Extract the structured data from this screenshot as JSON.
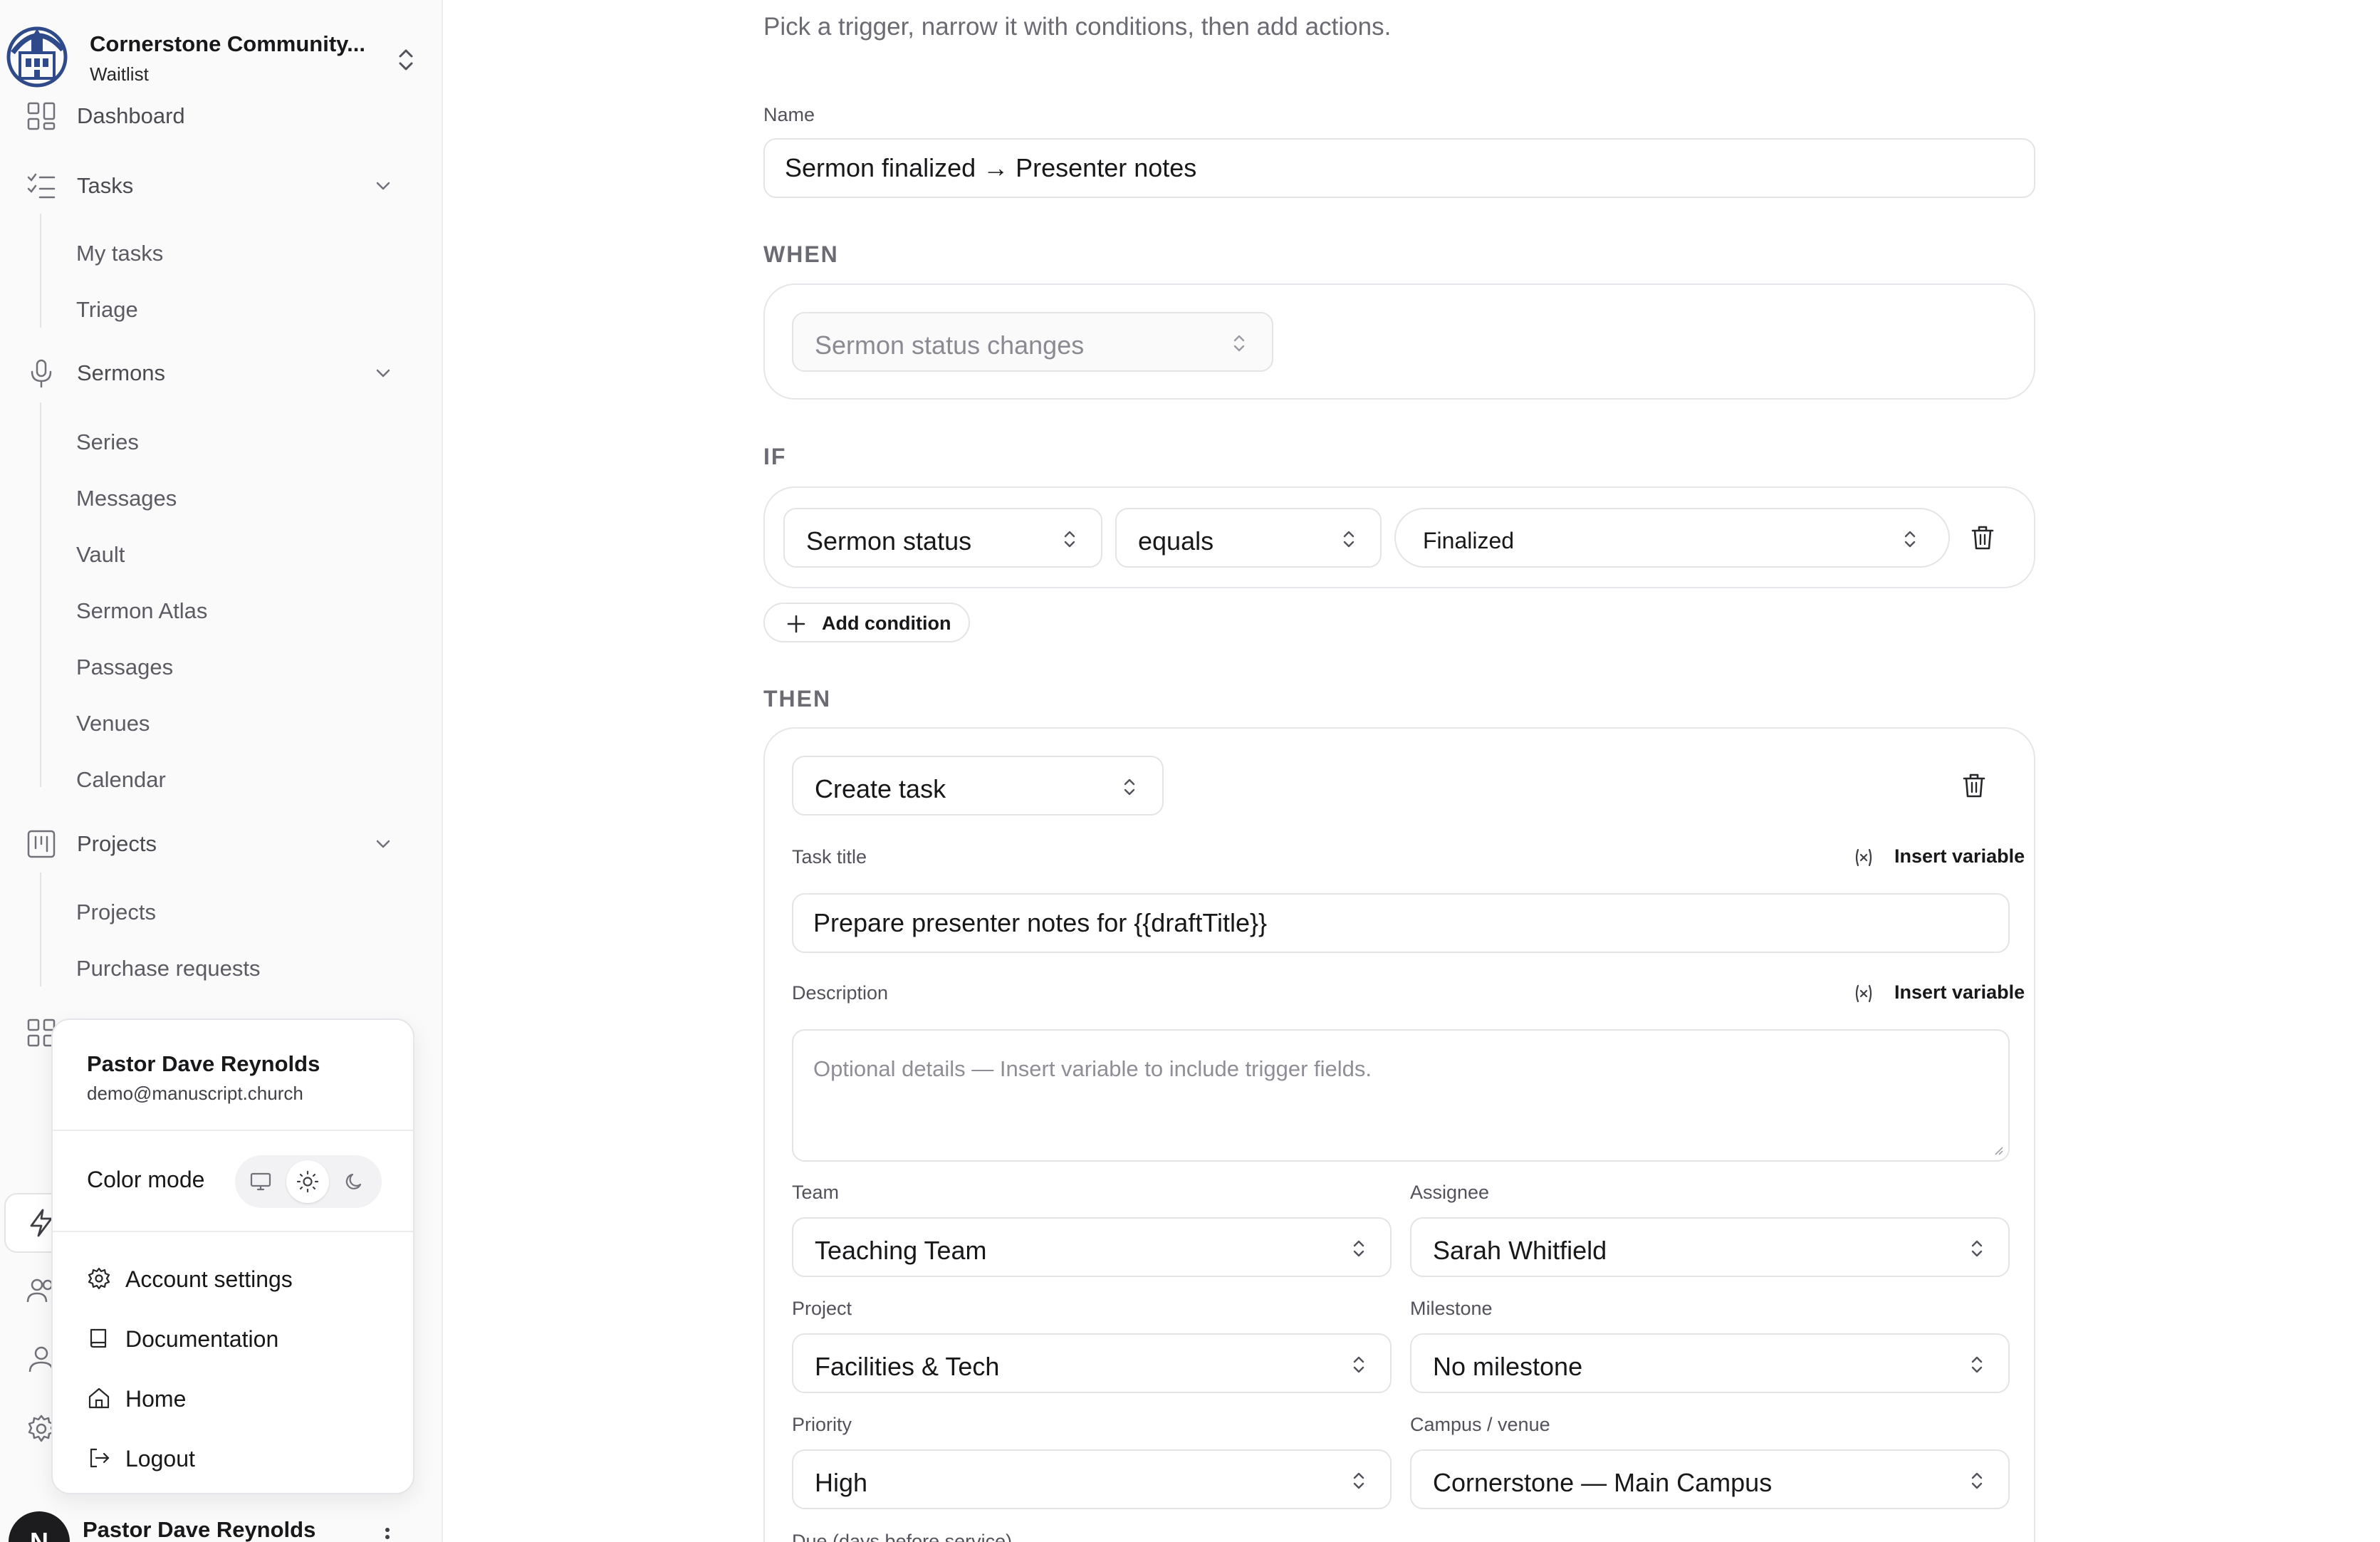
{
  "org": {
    "name": "Cornerstone Community...",
    "plan": "Waitlist"
  },
  "nav": {
    "dashboard": "Dashboard",
    "tasks": {
      "label": "Tasks",
      "items": [
        "My tasks",
        "Triage"
      ]
    },
    "sermons": {
      "label": "Sermons",
      "items": [
        "Series",
        "Messages",
        "Vault",
        "Sermon Atlas",
        "Passages",
        "Venues",
        "Calendar"
      ]
    },
    "projects": {
      "label": "Projects",
      "items": [
        "Projects",
        "Purchase requests"
      ]
    }
  },
  "user_menu": {
    "name": "Pastor Dave Reynolds",
    "email": "demo@manuscript.church",
    "color_mode_label": "Color mode",
    "color_modes": [
      "system",
      "light",
      "dark"
    ],
    "color_mode_selected": "light",
    "items": [
      "Account settings",
      "Documentation",
      "Home",
      "Logout"
    ]
  },
  "footer_user": {
    "initial": "N",
    "name": "Pastor Dave Reynolds"
  },
  "form": {
    "intro": "Pick a trigger, narrow it with conditions, then add actions.",
    "name_label": "Name",
    "name_value": "Sermon finalized → Presenter notes",
    "when": {
      "label": "WHEN",
      "trigger": "Sermon status changes"
    },
    "if": {
      "label": "IF",
      "field": "Sermon status",
      "operator": "equals",
      "value": "Finalized",
      "add_condition": "Add condition"
    },
    "then": {
      "label": "THEN",
      "action": "Create task",
      "task_title_label": "Task title",
      "task_title_value": "Prepare presenter notes for {{draftTitle}}",
      "insert_variable": "Insert variable",
      "description_label": "Description",
      "description_placeholder": "Optional details — Insert variable to include trigger fields.",
      "team_label": "Team",
      "team_value": "Teaching Team",
      "assignee_label": "Assignee",
      "assignee_value": "Sarah Whitfield",
      "project_label": "Project",
      "project_value": "Facilities & Tech",
      "milestone_label": "Milestone",
      "milestone_value": "No milestone",
      "priority_label": "Priority",
      "priority_value": "High",
      "campus_label": "Campus / venue",
      "campus_value": "Cornerstone — Main Campus",
      "due_label": "Due (days before service)"
    }
  },
  "colors": {
    "text": "#18181b",
    "muted": "#6b6b73",
    "border": "#e4e4e7",
    "sidebar_bg": "#fafafa"
  }
}
